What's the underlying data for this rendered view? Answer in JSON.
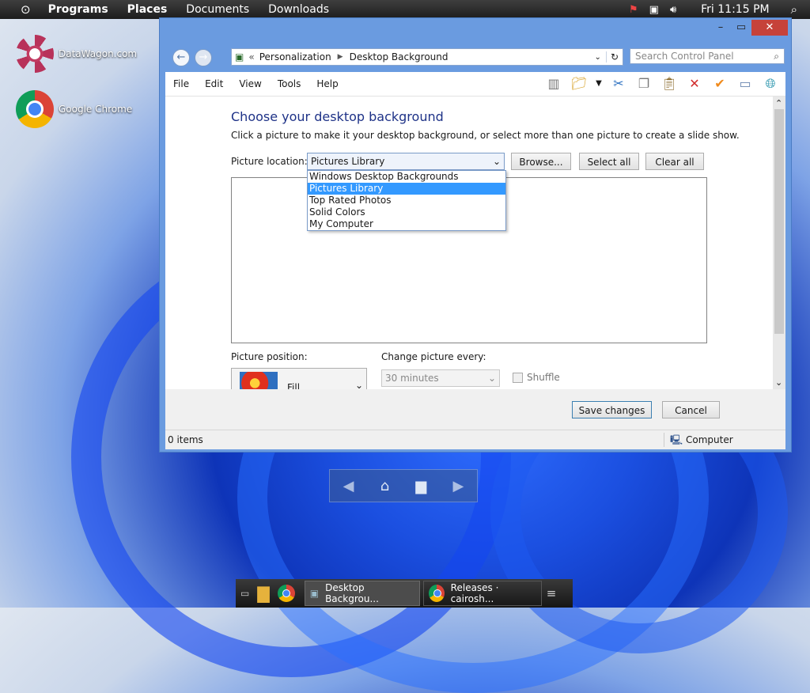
{
  "topbar": {
    "menus": [
      "Programs",
      "Places",
      "Documents",
      "Downloads"
    ],
    "clock": "Fri 11:15 PM"
  },
  "desktop_icons": [
    {
      "label": "DataWagon.com"
    },
    {
      "label": "Google Chrome"
    }
  ],
  "window": {
    "breadcrumb": [
      "Personalization",
      "Desktop Background"
    ],
    "search_placeholder": "Search Control Panel",
    "menu": [
      "File",
      "Edit",
      "View",
      "Tools",
      "Help"
    ],
    "heading": "Choose your desktop background",
    "subheading": "Click a picture to make it your desktop background, or select more than one picture to create a slide show.",
    "picture_location_label": "Picture location:",
    "picture_location_value": "Pictures Library",
    "browse_label": "Browse...",
    "select_all_label": "Select all",
    "clear_all_label": "Clear all",
    "dropdown_options": [
      "Windows Desktop Backgrounds",
      "Pictures Library",
      "Top Rated Photos",
      "Solid Colors",
      "My Computer"
    ],
    "picture_position_label": "Picture position:",
    "picture_position_value": "Fill",
    "change_every_label": "Change picture every:",
    "change_every_value": "30 minutes",
    "shuffle_label": "Shuffle",
    "save_label": "Save changes",
    "cancel_label": "Cancel",
    "status_left": "0 items",
    "status_right": "Computer"
  },
  "taskbar": {
    "tasks": [
      "Desktop Backgrou...",
      "Releases · cairosh..."
    ]
  }
}
